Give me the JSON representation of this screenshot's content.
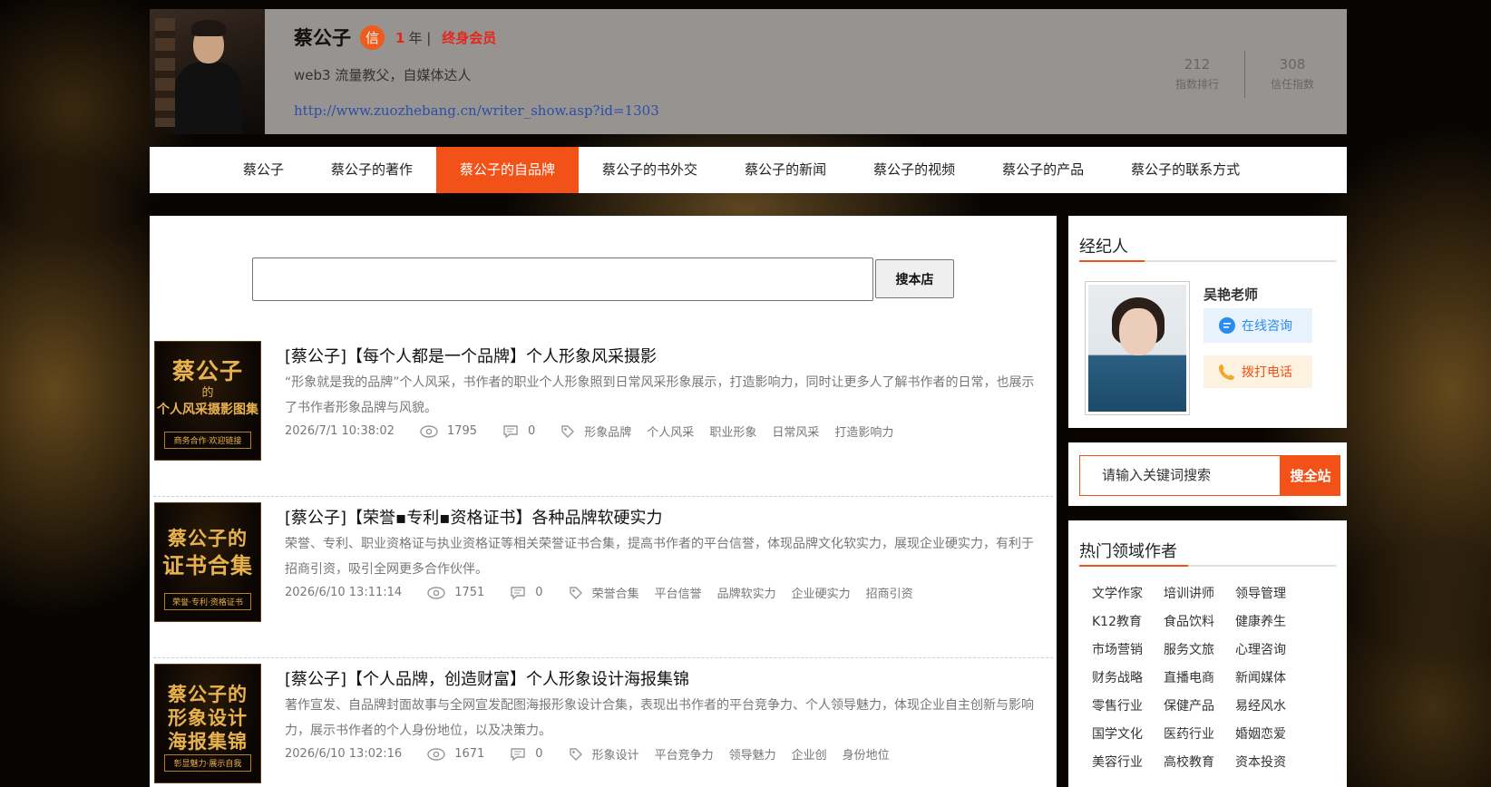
{
  "profile": {
    "name": "蔡公子",
    "credit_badge": "信",
    "years": "1",
    "years_unit": "年 |",
    "membership": "终身会员",
    "bio": "web3 流量教父，自媒体达人",
    "url": "http://www.zuozhebang.cn/writer_show.asp?id=1303",
    "stats": [
      {
        "value": "212",
        "label": "指数排行"
      },
      {
        "value": "308",
        "label": "信任指数"
      }
    ]
  },
  "nav": {
    "items": [
      "蔡公子",
      "蔡公子的著作",
      "蔡公子的自品牌",
      "蔡公子的书外交",
      "蔡公子的新闻",
      "蔡公子的视频",
      "蔡公子的产品",
      "蔡公子的联系方式"
    ],
    "active_index": 2
  },
  "store_search": {
    "value": "",
    "button": "搜本店"
  },
  "articles": [
    {
      "thumb_big": "蔡公子",
      "thumb_small": "的",
      "thumb_sub": "个人风采摄影图集",
      "thumb_tagline": "商务合作·欢迎链接",
      "title": "[蔡公子]【每个人都是一个品牌】个人形象风采摄影",
      "desc": "“形象就是我的品牌”个人风采，书作者的职业个人形象照到日常风采形象展示，打造影响力，同时让更多人了解书作者的日常，也展示了书作者形象品牌与风貌。",
      "date": "2026/7/1 10:38:02",
      "views": "1795",
      "comments": "0",
      "tags": [
        "形象品牌",
        "个人风采",
        "职业形象",
        "日常风采",
        "打造影响力"
      ]
    },
    {
      "thumb_big": "蔡公子的",
      "thumb_small": "",
      "thumb_sub": "证书合集",
      "thumb_tagline": "荣誉·专利·资格证书",
      "title": "[蔡公子]【荣誉▪专利▪资格证书】各种品牌软硬实力",
      "desc": "荣誉、专利、职业资格证与执业资格证等相关荣誉证书合集，提高书作者的平台信誉，体现品牌文化软实力，展现企业硬实力，有利于招商引资，吸引全网更多合作伙伴。",
      "date": "2026/6/10 13:11:14",
      "views": "1751",
      "comments": "0",
      "tags": [
        "荣誉合集",
        "平台信誉",
        "品牌软实力",
        "企业硬实力",
        "招商引资"
      ]
    },
    {
      "thumb_big": "蔡公子的",
      "thumb_small": "形象设计",
      "thumb_sub": "海报集锦",
      "thumb_tagline": "彰显魅力·展示自我",
      "title": "[蔡公子]【个人品牌，创造财富】个人形象设计海报集锦",
      "desc": "著作宣发、自品牌封面故事与全网宣发配图海报形象设计合集，表现出书作者的平台竞争力、个人领导魅力，体现企业自主创新与影响力，展示书作者的个人身份地位，以及决策力。",
      "date": "2026/6/10 13:02:16",
      "views": "1671",
      "comments": "0",
      "tags": [
        "形象设计",
        "平台竞争力",
        "领导魅力",
        "企业创",
        "身份地位"
      ]
    }
  ],
  "agent": {
    "title": "经纪人",
    "name": "吴艳老师",
    "consult": "在线咨询",
    "call": "拨打电话"
  },
  "site_search": {
    "placeholder": "请输入关键词搜索",
    "button": "搜全站"
  },
  "hot": {
    "title": "热门领域作者",
    "items": [
      "文学作家",
      "培训讲师",
      "领导管理",
      "K12教育",
      "食品饮料",
      "健康养生",
      "市场营销",
      "服务文旅",
      "心理咨询",
      "财务战略",
      "直播电商",
      "新闻媒体",
      "零售行业",
      "保健产品",
      "易经风水",
      "国学文化",
      "医药行业",
      "婚姻恋爱",
      "美容行业",
      "高校教育",
      "资本投资"
    ]
  },
  "colors": {
    "accent": "#f25118",
    "red": "#e5261b",
    "link": "#2a4fa6",
    "consult": "#2b8cf0"
  }
}
